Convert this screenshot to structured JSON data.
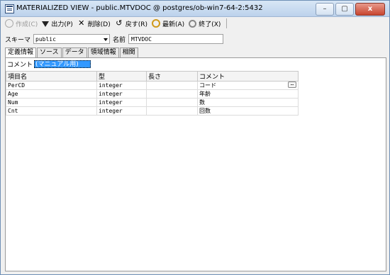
{
  "window": {
    "title": "MATERIALIZED VIEW - public.MTVDOC @ postgres/ob-win7-64-2:5432",
    "min_label": "–",
    "max_label": "▢",
    "close_label": "x"
  },
  "toolbar": {
    "create_label": "作成(C)",
    "output_label": "出力(P)",
    "delete_label": "削除(D)",
    "revert_label": "戻す(R)",
    "refresh_label": "最新(A)",
    "exit_label": "終了(X)"
  },
  "form": {
    "schema_label": "スキーマ",
    "schema_value": "public",
    "name_label": "名前",
    "name_value": "MTVDOC"
  },
  "tabs": [
    "定義情報",
    "ソース",
    "データ",
    "領域情報",
    "相関"
  ],
  "comment": {
    "label": "コメント",
    "value": "(マニュアル用)"
  },
  "grid": {
    "headers": [
      "項目名",
      "型",
      "長さ",
      "コメント"
    ],
    "rows": [
      [
        "PerCD",
        "integer",
        "",
        "コード"
      ],
      [
        "Age",
        "integer",
        "",
        "年齢"
      ],
      [
        "Num",
        "integer",
        "",
        "数"
      ],
      [
        "Cnt",
        "integer",
        "",
        "回数"
      ]
    ],
    "ellipsis_label": "…"
  }
}
